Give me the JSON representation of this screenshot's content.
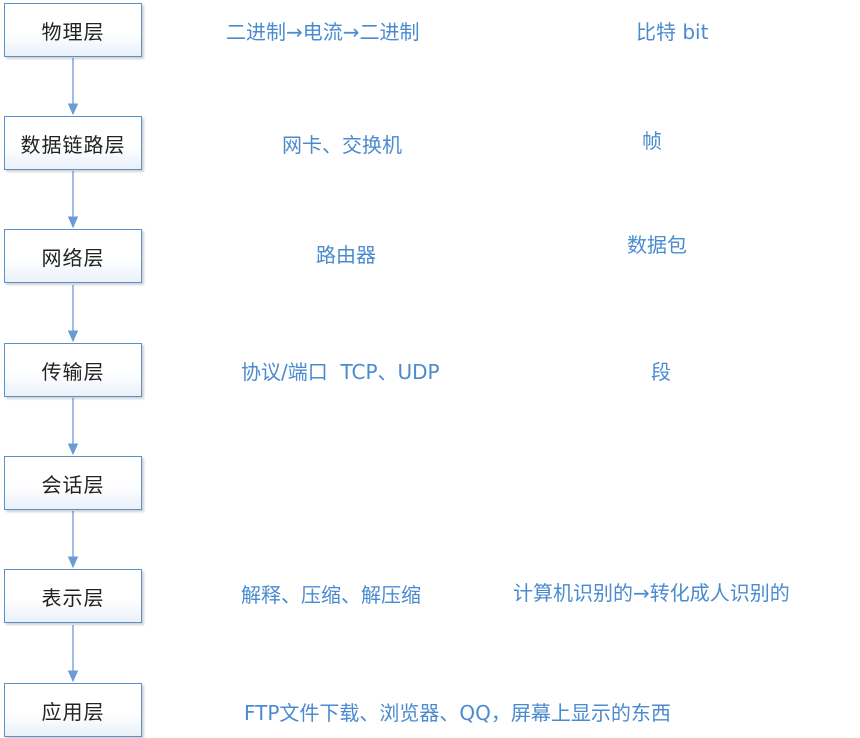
{
  "layers": [
    {
      "name": "物理层",
      "device": "二进制→电流→二进制",
      "unit": "比特 bit"
    },
    {
      "name": "数据链路层",
      "device": "网卡、交换机",
      "unit": "帧"
    },
    {
      "name": "网络层",
      "device": "路由器",
      "unit": "数据包"
    },
    {
      "name": "传输层",
      "device": "协议/端口  TCP、UDP",
      "unit": "段"
    },
    {
      "name": "会话层",
      "device": "",
      "unit": ""
    },
    {
      "name": "表示层",
      "device": "解释、压缩、解压缩",
      "unit": "计算机识别的→转化成人识别的"
    },
    {
      "name": "应用层",
      "device": "FTP文件下载、浏览器、QQ，屏幕上显示的东西",
      "unit": ""
    }
  ],
  "colors": {
    "box_border": "#5b8fc8",
    "text_blue": "#4a8bd0",
    "arrow": "#6a9bd4"
  }
}
